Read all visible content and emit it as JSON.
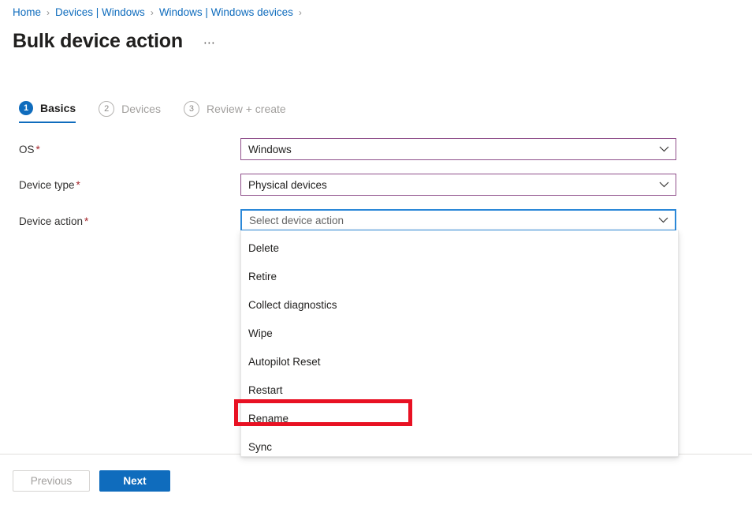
{
  "breadcrumb": {
    "items": [
      {
        "label": "Home"
      },
      {
        "label": "Devices | Windows"
      },
      {
        "label": "Windows | Windows devices"
      }
    ],
    "separator": "›"
  },
  "header": {
    "title": "Bulk device action",
    "more_menu": "⋯"
  },
  "wizard": {
    "tabs": [
      {
        "number": "1",
        "label": "Basics",
        "state": "active"
      },
      {
        "number": "2",
        "label": "Devices",
        "state": "inactive"
      },
      {
        "number": "3",
        "label": "Review + create",
        "state": "inactive"
      }
    ]
  },
  "form": {
    "required_marker": "*",
    "fields": [
      {
        "label": "OS",
        "value": "Windows",
        "is_placeholder": false,
        "border": "plum"
      },
      {
        "label": "Device type",
        "value": "Physical devices",
        "is_placeholder": false,
        "border": "plum"
      },
      {
        "label": "Device action",
        "value": "Select device action",
        "is_placeholder": true,
        "border": "focused"
      }
    ]
  },
  "dropdown": {
    "open": true,
    "options": [
      {
        "label": "Delete"
      },
      {
        "label": "Retire"
      },
      {
        "label": "Collect diagnostics"
      },
      {
        "label": "Wipe"
      },
      {
        "label": "Autopilot Reset"
      },
      {
        "label": "Restart"
      },
      {
        "label": "Rename"
      },
      {
        "label": "Sync"
      }
    ],
    "highlighted_option": "Rename"
  },
  "footer": {
    "previous_label": "Previous",
    "next_label": "Next"
  },
  "colors": {
    "accent_blue": "#0f6cbd",
    "focus_blue": "#2b88d8",
    "plum_border": "#8f4f8b",
    "required_red": "#a4262c",
    "annotation_red": "#e81123"
  }
}
